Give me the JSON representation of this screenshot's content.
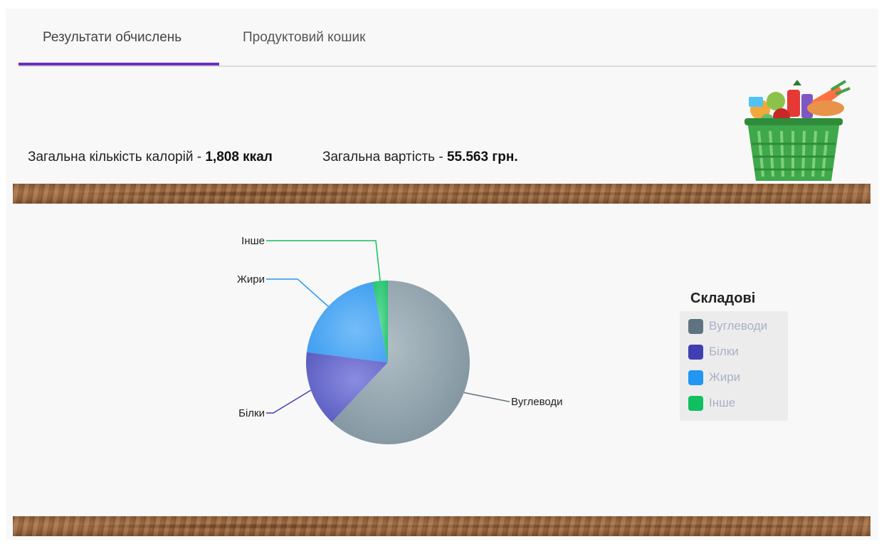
{
  "tabs": [
    {
      "label": "Результати обчислень",
      "active": true
    },
    {
      "label": "Продуктовий кошик",
      "active": false
    }
  ],
  "summary": {
    "calories_label": "Загальна кількість калорій - ",
    "calories_value": "1,808 ккал",
    "cost_label": "Загальна вартість - ",
    "cost_value": "55.563 грн."
  },
  "legend": {
    "title": "Складові"
  },
  "chart_data": {
    "type": "pie",
    "categories": [
      "Вуглеводи",
      "Білки",
      "Жири",
      "Інше"
    ],
    "values": [
      62,
      15,
      20,
      3
    ],
    "colors": [
      "#90a4ae",
      "#5c5fc4",
      "#42a5f5",
      "#2ecc7a"
    ],
    "legend_colors": [
      "#5f7480",
      "#3f3fb4",
      "#2196f3",
      "#10c060"
    ],
    "legend_placement": "right"
  },
  "colors": {
    "accent": "#6a2fc0"
  },
  "images": {
    "basket": "grocery-basket-icon"
  }
}
